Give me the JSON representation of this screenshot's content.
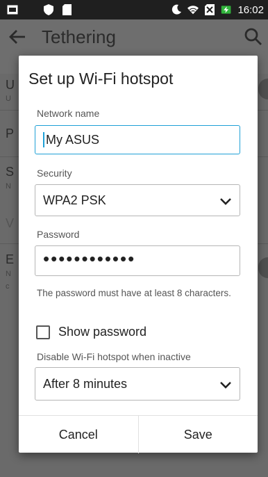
{
  "status_bar": {
    "time": "16:02",
    "icons": [
      "screen-cast-icon",
      "call-icon",
      "shield-icon",
      "sd-card-icon",
      "moon-icon",
      "wifi-icon",
      "no-sim-icon",
      "battery-charging-icon"
    ]
  },
  "app": {
    "title": "Tethering",
    "background_letters": [
      "U",
      "U",
      "P",
      "S",
      "N",
      "V",
      "E",
      "N",
      "c"
    ]
  },
  "dialog": {
    "title": "Set up Wi-Fi hotspot",
    "network_name_label": "Network name",
    "network_name_value": "My ASUS",
    "security_label": "Security",
    "security_value": "WPA2 PSK",
    "password_label": "Password",
    "password_value": "••••••••••••",
    "password_hint": "The password must have at least 8 characters.",
    "show_password_label": "Show password",
    "show_password_checked": false,
    "inactive_label": "Disable Wi-Fi hotspot when inactive",
    "inactive_value": "After 8 minutes",
    "cancel_label": "Cancel",
    "save_label": "Save"
  },
  "colors": {
    "accent": "#1ea0d6",
    "status_bar": "#1f1f1f",
    "scrim": "#6a6a6a"
  }
}
